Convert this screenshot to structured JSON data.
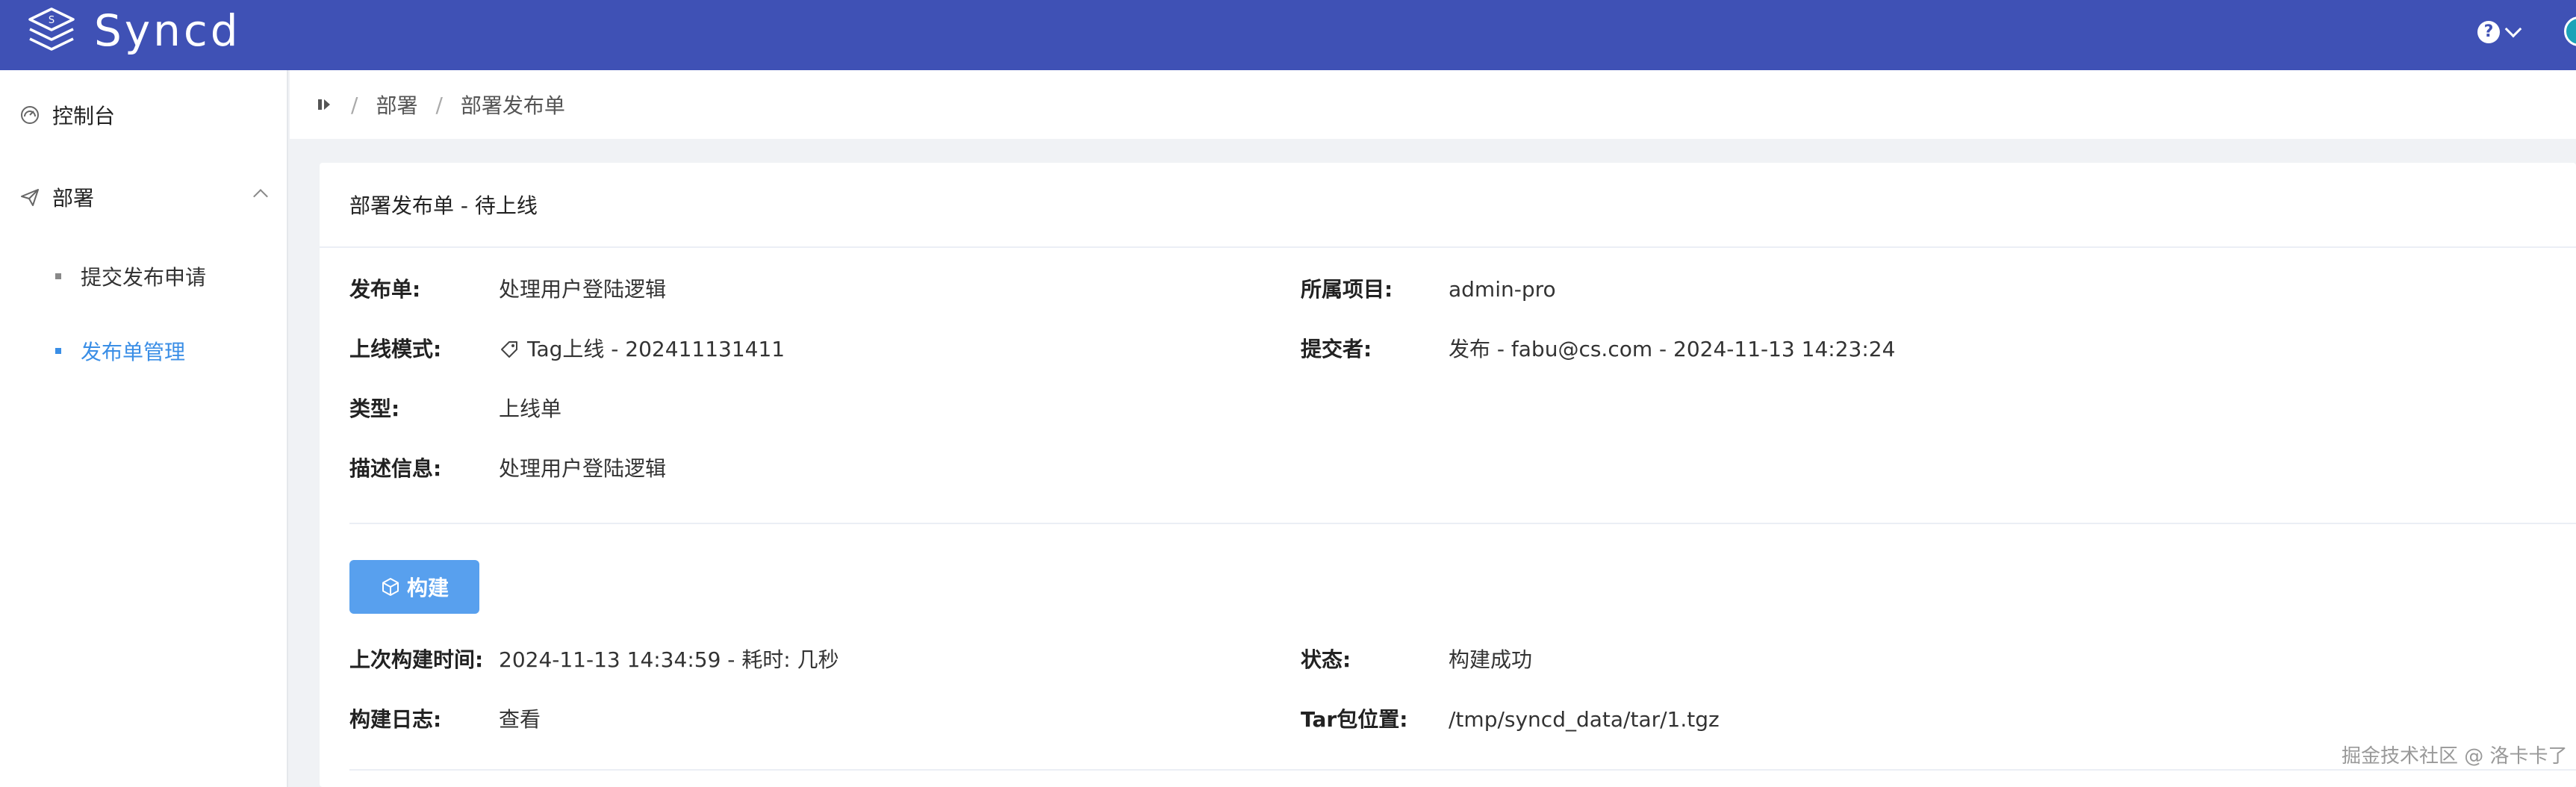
{
  "app": {
    "title": "Syncd"
  },
  "sidebar": {
    "items": [
      {
        "label": "控制台",
        "icon": "dashboard-icon"
      },
      {
        "label": "部署",
        "icon": "paper-plane-icon",
        "expanded": true,
        "children": [
          {
            "label": "提交发布申请"
          },
          {
            "label": "发布单管理",
            "active": true
          }
        ]
      }
    ]
  },
  "breadcrumb": {
    "items": [
      "部署",
      "部署发布单"
    ]
  },
  "card": {
    "title": "部署发布单 - 待上线",
    "fields": {
      "release": {
        "label": "发布单:",
        "value": "处理用户登陆逻辑"
      },
      "project": {
        "label": "所属项目:",
        "value": "admin-pro"
      },
      "mode": {
        "label": "上线模式:",
        "value": "Tag上线 - 202411131411",
        "icon": "tag-icon"
      },
      "submitter": {
        "label": "提交者:",
        "value": "发布 - fabu@cs.com - 2024-11-13 14:23:24"
      },
      "type": {
        "label": "类型:",
        "value": "上线单"
      },
      "desc": {
        "label": "描述信息:",
        "value": "处理用户登陆逻辑"
      }
    },
    "build": {
      "button_label": "构建",
      "last_time": {
        "label": "上次构建时间:",
        "value": "2024-11-13 14:34:59 - 耗时: 几秒"
      },
      "status": {
        "label": "状态:",
        "value": "构建成功"
      },
      "log": {
        "label": "构建日志:",
        "value": "查看"
      },
      "tar": {
        "label": "Tar包位置:",
        "value": "/tmp/syncd_data/tar/1.tgz"
      }
    }
  },
  "watermark": "掘金技术社区 @ 洛卡卡了",
  "colors": {
    "header": "#3f51b5",
    "accent": "#3a8ee6",
    "success": "#67c23a",
    "button": "#58a0ee"
  }
}
